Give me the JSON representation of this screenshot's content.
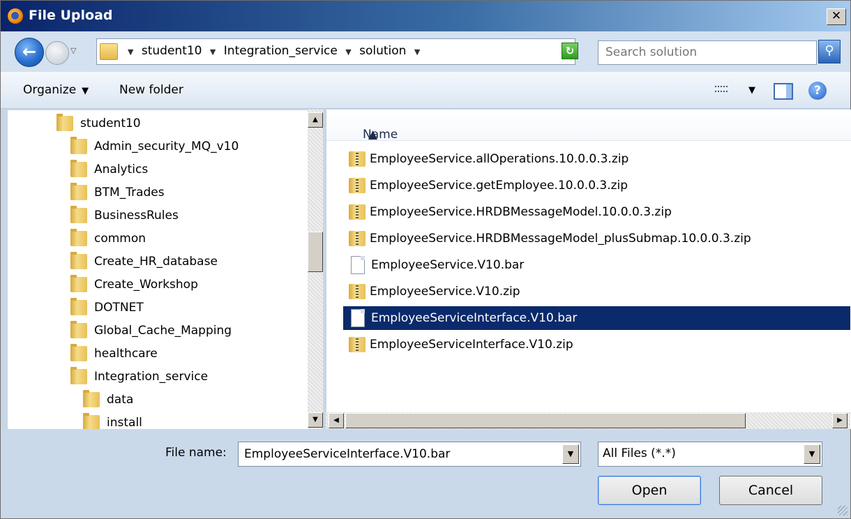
{
  "window": {
    "title": "File Upload"
  },
  "nav": {
    "breadcrumbs": [
      "student10",
      "Integration_service",
      "solution"
    ],
    "search_placeholder": "Search solution"
  },
  "toolbar": {
    "organize_label": "Organize",
    "new_folder_label": "New folder"
  },
  "tree": {
    "items": [
      {
        "label": "student10"
      },
      {
        "label": "Admin_security_MQ_v10"
      },
      {
        "label": "Analytics"
      },
      {
        "label": "BTM_Trades"
      },
      {
        "label": "BusinessRules"
      },
      {
        "label": "common"
      },
      {
        "label": "Create_HR_database"
      },
      {
        "label": "Create_Workshop"
      },
      {
        "label": "DOTNET"
      },
      {
        "label": "Global_Cache_Mapping"
      },
      {
        "label": "healthcare"
      },
      {
        "label": "Integration_service"
      },
      {
        "label": "data"
      },
      {
        "label": "install"
      }
    ]
  },
  "list": {
    "column_header": "Name",
    "files": [
      {
        "name": "EmployeeService.allOperations.10.0.0.3.zip",
        "icon": "zip-folder-icon"
      },
      {
        "name": "EmployeeService.getEmployee.10.0.0.3.zip",
        "icon": "zip-folder-icon"
      },
      {
        "name": "EmployeeService.HRDBMessageModel.10.0.0.3.zip",
        "icon": "zip-folder-icon"
      },
      {
        "name": "EmployeeService.HRDBMessageModel_plusSubmap.10.0.0.3.zip",
        "icon": "zip-folder-icon"
      },
      {
        "name": "EmployeeService.V10.bar",
        "icon": "document-icon"
      },
      {
        "name": "EmployeeService.V10.zip",
        "icon": "zip-folder-icon"
      },
      {
        "name": "EmployeeServiceInterface.V10.bar",
        "icon": "document-icon",
        "selected": true
      },
      {
        "name": "EmployeeServiceInterface.V10.zip",
        "icon": "zip-folder-icon"
      }
    ]
  },
  "bottom": {
    "file_name_label": "File name:",
    "file_name_value": "EmployeeServiceInterface.V10.bar",
    "file_type": "All Files (*.*)",
    "open_label": "Open",
    "cancel_label": "Cancel"
  },
  "colors": {
    "selection": "#0b2a6b",
    "titlebar": "#0a246a"
  }
}
